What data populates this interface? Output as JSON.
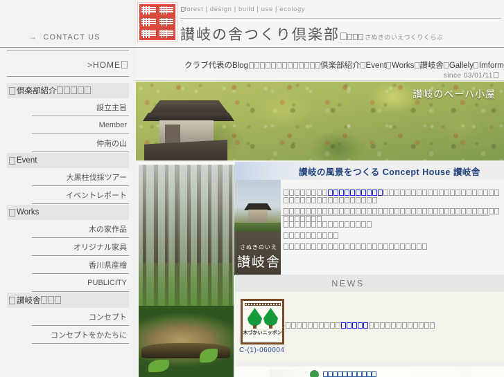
{
  "header": {
    "seal_alt": "讃岐舎倶楽部 red seal",
    "tagline": "forest | design | build | use | ecology",
    "site_title_cjk": "讃岐の舎つくり倶楽部",
    "site_title_tofu_count": 10,
    "site_title_ruby": "さぬきのいえつくりくらぶ",
    "site_title_ruby_tofu_count": 12,
    "title_gap_boxes": 3
  },
  "contact": {
    "arrow": "→",
    "label": "CONTACT US"
  },
  "home": {
    "label": ">HOME",
    "trailing_boxes": 1
  },
  "topnav": {
    "blog_label": "クラブ代表のBlog",
    "blog_tofu_count": 13,
    "items": [
      {
        "name": "club-intro",
        "label": "倶楽部紹介",
        "tofu": 5
      },
      {
        "name": "event",
        "label": "Event",
        "tofu": 0
      },
      {
        "name": "works",
        "label": "Works",
        "tofu": 0
      },
      {
        "name": "sanukisha",
        "label": "讃岐舎",
        "tofu": 3
      },
      {
        "name": "gallely",
        "label": "Gallely",
        "tofu": 0
      },
      {
        "name": "imformation",
        "label": "Imformation",
        "tofu": 0
      }
    ],
    "since": "since 03/01/11"
  },
  "sidebar": {
    "groups": [
      {
        "head": "倶楽部紹介",
        "head_tofu": 5,
        "items": [
          {
            "label": "設立主旨",
            "tofu": 4
          },
          {
            "label": "Member",
            "tofu": 0
          },
          {
            "label": "仲南の山",
            "tofu": 4
          }
        ]
      },
      {
        "head": "Event",
        "head_tofu": 0,
        "items": [
          {
            "label": "大黒柱伐採ツアー",
            "tofu": 8
          },
          {
            "label": "イベントレポート",
            "tofu": 8
          }
        ]
      },
      {
        "head": "Works",
        "head_tofu": 0,
        "items": [
          {
            "label": "木の家作品",
            "tofu": 5
          },
          {
            "label": "オリジナル家具",
            "tofu": 7
          },
          {
            "label": "香川県産檜",
            "tofu": 5
          },
          {
            "label": "PUBLICITY",
            "tofu": 0
          }
        ]
      },
      {
        "head": "讃岐舎",
        "head_tofu": 3,
        "items": [
          {
            "label": "コンセプト",
            "tofu": 5
          },
          {
            "label": "コンセプトをかたちに",
            "tofu": 10
          }
        ]
      }
    ]
  },
  "banner": {
    "caption": "讃岐のベーハ小屋",
    "caption_tofu": 8,
    "photo_alt": "traditional Japanese storehouse against autumn hillside foliage"
  },
  "photos": {
    "forest_alt": "misty cedar forest",
    "log_alt": "cut log on green moss",
    "house_alt": "small traditional house in a field"
  },
  "calligraphy": {
    "ruby": "さぬきのいえ",
    "ruby_tofu": 6,
    "main": "讃岐舎",
    "main_tofu": 3
  },
  "concept": {
    "title": "讃岐の風景をつくる  Concept House 讃岐舎",
    "title_lead_tofu": 7,
    "title_mid": "Concept House",
    "title_tail_tofu": 3,
    "paragraph_lines": [
      {
        "pre_tofu": 8,
        "link_tofu": 10,
        "post_tofu": 38
      },
      {
        "pre_tofu": 0,
        "link_tofu": 0,
        "post_tofu": 46
      }
    ],
    "detail_lines": [
      {
        "tofu": 16
      },
      {
        "tofu": 10
      },
      {
        "tofu": 26
      }
    ]
  },
  "news": {
    "title": "NEWS",
    "wood_mark": {
      "top_text_tofu": 13,
      "bottom_label": "木づかいニッポン",
      "bottom_tofu": 8,
      "code": "C-(1)-060004",
      "border_color": "#7a4a28",
      "leaf_color": "#159a3c",
      "code_color": "#2a4a9a"
    },
    "item": {
      "bullet_tofu": 1,
      "pre_tofu": 9,
      "link_tofu": 5,
      "post_tofu": 12
    }
  },
  "bottom_banner": {
    "text_tofu": 11,
    "globe_color": "#3d9b4a"
  },
  "colors": {
    "page_bg": "#f5f5f3",
    "sidebar_bg": "#f2f2f0",
    "sidebar_head_bg": "#e4e4e2",
    "rule": "#9a9a9a",
    "concept_accent": "#22437e",
    "news_bg": "#f4f3ec",
    "link_blue": "#1a1aff",
    "seal_red": "#d94a3d"
  }
}
